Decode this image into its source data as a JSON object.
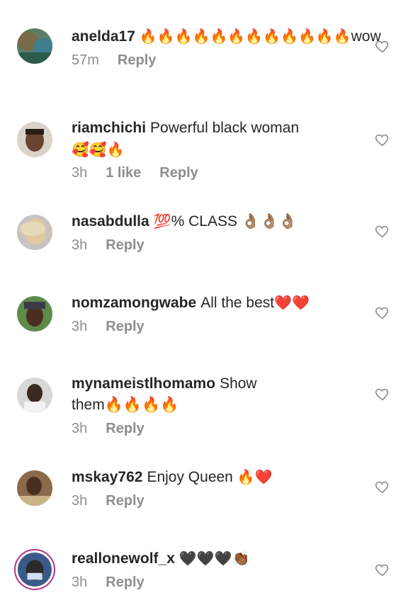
{
  "comments": [
    {
      "username": "anelda17",
      "text": "",
      "emoji": "🔥🔥🔥🔥🔥🔥🔥🔥🔥🔥🔥🔥",
      "text_after": "wow",
      "line2": "",
      "time": "57m",
      "likes": "",
      "reply": "Reply"
    },
    {
      "username": "riamchichi",
      "text": "Powerful black woman",
      "emoji": "",
      "text_after": "",
      "line2": "🥰🥰🔥",
      "time": "3h",
      "likes": "1 like",
      "reply": "Reply"
    },
    {
      "username": "nasabdulla",
      "text": "",
      "emoji": "💯",
      "text_after": "% CLASS 👌🏽👌🏽👌🏽",
      "line2": "",
      "time": "3h",
      "likes": "",
      "reply": "Reply"
    },
    {
      "username": "nomzamongwabe",
      "text": "All the best",
      "emoji": "❤️❤️",
      "text_after": "",
      "line2": "",
      "time": "3h",
      "likes": "",
      "reply": "Reply"
    },
    {
      "username": "mynameistlhomamo",
      "text": "Show",
      "emoji": "",
      "text_after": "",
      "line2": "them🔥🔥🔥🔥",
      "time": "3h",
      "likes": "",
      "reply": "Reply"
    },
    {
      "username": "mskay762",
      "text": "Enjoy Queen",
      "emoji": "🔥❤️",
      "text_after": "",
      "line2": "",
      "time": "3h",
      "likes": "",
      "reply": "Reply"
    },
    {
      "username": "reallonewolf_x",
      "text": "",
      "emoji": "🖤🖤🖤👏🏾",
      "text_after": "",
      "line2": "",
      "time": "3h",
      "likes": "",
      "reply": "Reply"
    }
  ],
  "icons": {
    "like": "heart-outline-icon"
  },
  "colors": {
    "meta": "#8e8e8e",
    "text": "#262626",
    "story_ring": "#b5348a"
  }
}
